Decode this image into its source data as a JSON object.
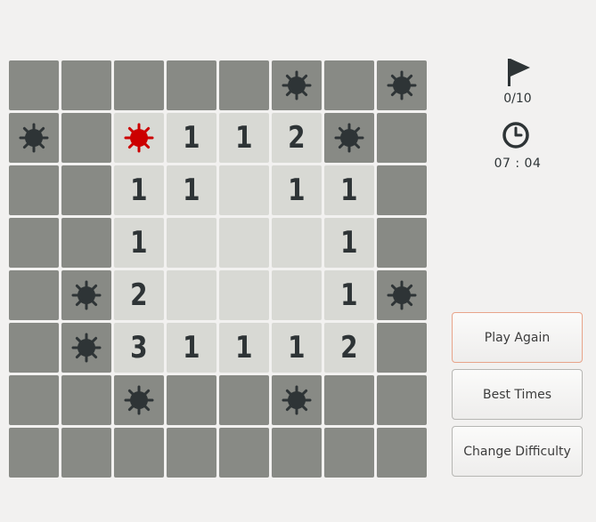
{
  "status": {
    "flags": "0/10",
    "time": "07 : 04"
  },
  "buttons": {
    "play_again": "Play Again",
    "best_times": "Best Times",
    "change_difficulty": "Change Difficulty"
  },
  "icons": {
    "flag": "flag-icon",
    "clock": "clock-icon",
    "mine": "mine-icon",
    "exploded_mine": "exploded-mine-icon"
  },
  "colors": {
    "covered": "#888a85",
    "revealed": "#d8d9d4",
    "mine": "#2e3436",
    "exploded_mine": "#cc0000",
    "number": "#2e3436",
    "play_again_border": "#e8a48a"
  },
  "board": {
    "rows": [
      [
        "C",
        "C",
        "C",
        "C",
        "C",
        "M",
        "C",
        "M"
      ],
      [
        "M",
        "C",
        "X",
        "1",
        "1",
        "2",
        "M",
        "C"
      ],
      [
        "C",
        "C",
        "1",
        "1",
        "E",
        "1",
        "1",
        "C"
      ],
      [
        "C",
        "C",
        "1",
        "E",
        "E",
        "E",
        "1",
        "C"
      ],
      [
        "C",
        "M",
        "2",
        "E",
        "E",
        "E",
        "1",
        "M"
      ],
      [
        "C",
        "M",
        "3",
        "1",
        "1",
        "1",
        "2",
        "C"
      ],
      [
        "C",
        "C",
        "M",
        "C",
        "C",
        "M",
        "C",
        "C"
      ],
      [
        "C",
        "C",
        "C",
        "C",
        "C",
        "C",
        "C",
        "C"
      ]
    ]
  }
}
